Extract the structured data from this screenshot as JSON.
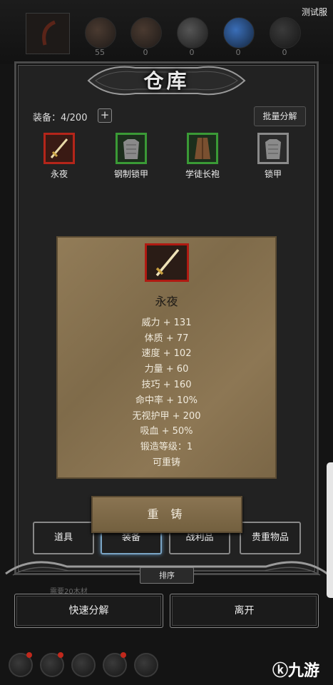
{
  "server_label": "测试服",
  "resources": [
    {
      "name": "resource-1",
      "value": "55"
    },
    {
      "name": "resource-2",
      "value": "0"
    },
    {
      "name": "resource-3",
      "value": "0"
    },
    {
      "name": "resource-4",
      "value": "0"
    },
    {
      "name": "resource-5",
      "value": "0"
    }
  ],
  "panel": {
    "title": "仓库",
    "equip_count": "装备：4/200",
    "plus": "+",
    "batch_decompose": "批量分解"
  },
  "inventory": [
    {
      "label": "永夜",
      "frame": "#b5251a",
      "icon": "dagger-icon"
    },
    {
      "label": "钢制锁甲",
      "frame": "#3a9a36",
      "icon": "chainmail-icon"
    },
    {
      "label": "学徒长袍",
      "frame": "#3a9a36",
      "icon": "robe-icon"
    },
    {
      "label": "锁甲",
      "frame": "#8a8a8a",
      "icon": "chainmail-icon"
    }
  ],
  "detail": {
    "name": "永夜",
    "stats": [
      "威力 + 131",
      "体质 + 77",
      "速度 + 102",
      "力量 + 60",
      "技巧 + 160",
      "命中率 + 10%",
      "无视护甲 + 200",
      "吸血 + 50%",
      "锻造等级：1",
      "可重铸"
    ],
    "reforge_label": "重 铸"
  },
  "tabs": [
    "道具",
    "装备",
    "战利品",
    "贵重物品"
  ],
  "active_tab": "装备",
  "sort_label": "排序",
  "need_material": "需要20木材",
  "quick_decompose": "快速分解",
  "leave": "离开",
  "watermark": "九游"
}
